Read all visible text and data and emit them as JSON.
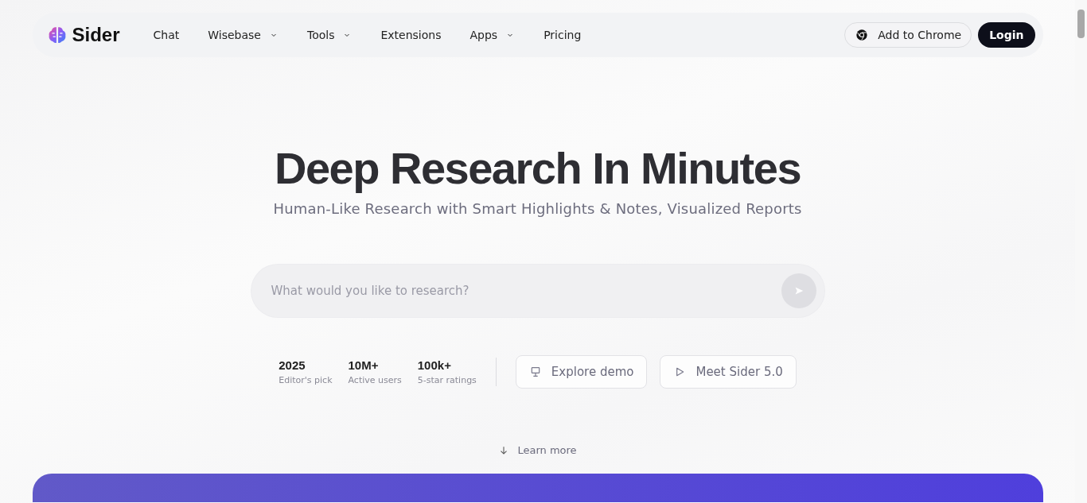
{
  "nav": {
    "brand": "Sider",
    "items": [
      {
        "label": "Chat",
        "has_menu": false
      },
      {
        "label": "Wisebase",
        "has_menu": true
      },
      {
        "label": "Tools",
        "has_menu": true
      },
      {
        "label": "Extensions",
        "has_menu": false
      },
      {
        "label": "Apps",
        "has_menu": true
      },
      {
        "label": "Pricing",
        "has_menu": false
      }
    ],
    "add_button": "Add to Chrome",
    "login_button": "Login"
  },
  "hero": {
    "title": "Deep Research In Minutes",
    "subtitle": "Human-Like Research with Smart Highlights & Notes, Visualized Reports",
    "search": {
      "placeholder": "What would you like to research?"
    },
    "stats": [
      {
        "value": "2025",
        "caption": "Editor's pick"
      },
      {
        "value": "10M+",
        "caption": "Active users"
      },
      {
        "value": "100k+",
        "caption": "5-star ratings"
      }
    ],
    "buttons": [
      {
        "kind": "demo",
        "label": "Explore demo"
      },
      {
        "kind": "video",
        "label": "Meet Sider 5.0"
      }
    ],
    "learn_more": "Learn more"
  }
}
